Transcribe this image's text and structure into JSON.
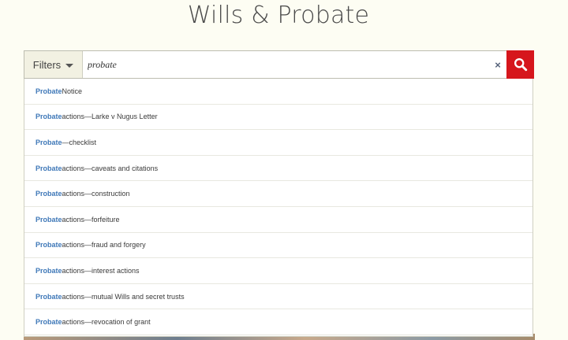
{
  "page": {
    "title": "Wills & Probate"
  },
  "search": {
    "filters_label": "Filters",
    "query": "probate",
    "clear_symbol": "×",
    "search_icon": "magnifier-icon",
    "accent_color": "#d6161c"
  },
  "suggestions": [
    {
      "match": "Probate",
      "rest": " Notice"
    },
    {
      "match": "Probate",
      "rest": " actions—Larke v Nugus Letter"
    },
    {
      "match": "Probate",
      "rest": "—checklist"
    },
    {
      "match": "Probate",
      "rest": " actions—caveats and citations"
    },
    {
      "match": "Probate",
      "rest": " actions—construction"
    },
    {
      "match": "Probate",
      "rest": " actions—forfeiture"
    },
    {
      "match": "Probate",
      "rest": " actions—fraud and forgery"
    },
    {
      "match": "Probate",
      "rest": " actions—interest actions"
    },
    {
      "match": "Probate",
      "rest": " actions—mutual Wills and secret trusts"
    },
    {
      "match": "Probate",
      "rest": " actions—revocation of grant"
    }
  ]
}
